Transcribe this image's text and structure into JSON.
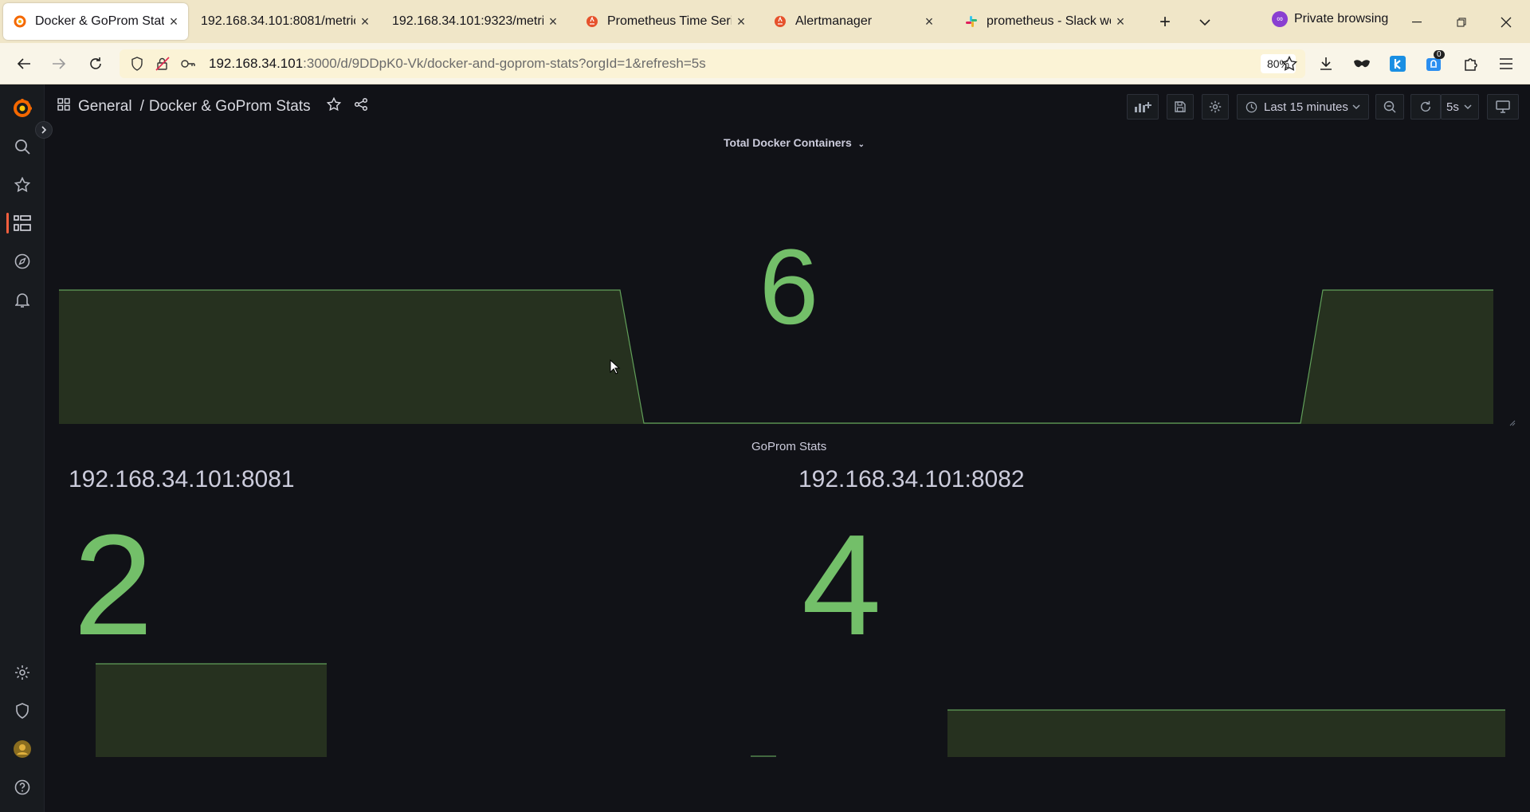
{
  "browser": {
    "tabs": [
      {
        "label": "Docker & GoProm Stats - ",
        "active": true
      },
      {
        "label": "192.168.34.101:8081/metrics"
      },
      {
        "label": "192.168.34.101:9323/metrics"
      },
      {
        "label": "Prometheus Time Series C"
      },
      {
        "label": "Alertmanager"
      },
      {
        "label": "prometheus - Slack work"
      }
    ],
    "private_label": "Private browsing",
    "url_host": "192.168.34.101",
    "url_rest": ":3000/d/9DDpK0-Vk/docker-and-goprom-stats?orgId=1&refresh=5s",
    "zoom": "80%",
    "notification_badge": "0"
  },
  "grafana": {
    "breadcrumb_folder": "General",
    "breadcrumb_separator": "/",
    "breadcrumb_dashboard": "Docker & GoProm Stats",
    "time_range": "Last 15 minutes",
    "refresh_interval": "5s",
    "colors": {
      "accent": "#f55f3e",
      "value_green": "#73bf69",
      "spark_fill": "#26311f"
    }
  },
  "panels": {
    "docker": {
      "title": "Total Docker Containers",
      "value": "6"
    },
    "goprom": {
      "title": "GoProm Stats",
      "left_instance": "192.168.34.101:8081",
      "left_value": "2",
      "right_instance": "192.168.34.101:8082",
      "right_value": "4"
    }
  }
}
